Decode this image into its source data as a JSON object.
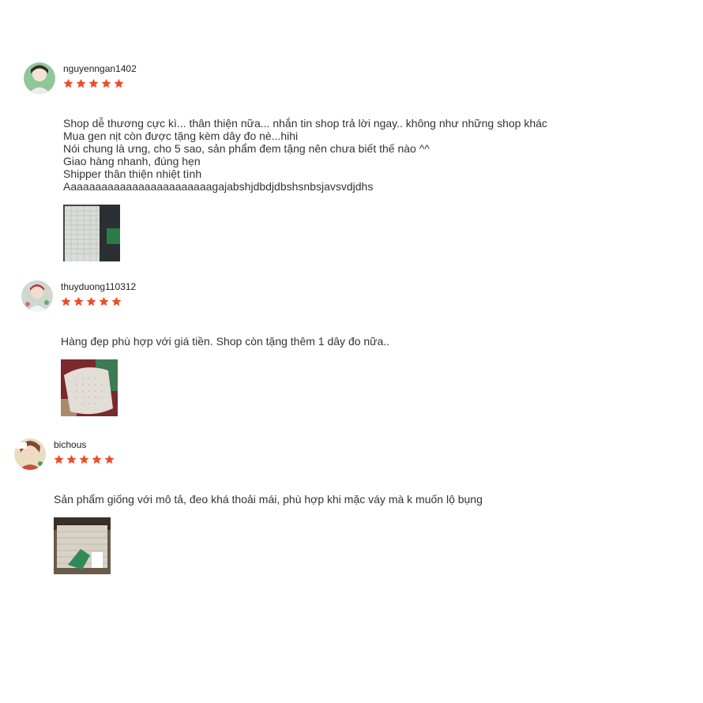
{
  "reviews": [
    {
      "username": "nguyenngan1402",
      "rating": 5,
      "comment_lines": [
        "Shop dễ thương cực kì... thân thiện nữa... nhắn tin shop trả lời ngay.. không như những shop khác",
        "Mua gen nịt còn được tặng kèm dây đo nè...hihi",
        "Nói chung là ưng, cho 5 sao, sản phẩm đem tặng nên chưa biết thế nào ^^",
        "Giao hàng nhanh, đúng hẹn",
        "Shipper thân thiện nhiệt tình",
        "Aaaaaaaaaaaaaaaaaaaaaaaagajabshjdbdjdbshsnbsjavsvdjdhs"
      ]
    },
    {
      "username": "thuyduong110312",
      "rating": 5,
      "comment_lines": [
        "Hàng đẹp phù hợp với giá tiền. Shop còn tặng thêm 1 dây đo nữa.."
      ]
    },
    {
      "username": "bichous",
      "rating": 5,
      "comment_lines": [
        "Sản phẩm giống với mô tả, đeo khá thoải mái, phù hợp khi mặc váy mà k muốn lộ bụng"
      ]
    }
  ],
  "colors": {
    "star": "#ee4d2d",
    "text": "#333333"
  },
  "icons": {
    "rating": "star-icon"
  }
}
